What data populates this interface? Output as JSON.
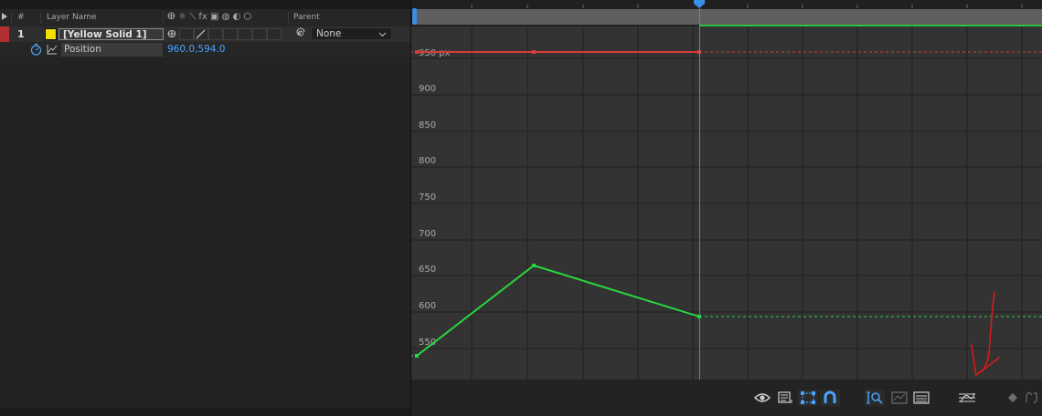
{
  "columns": {
    "number": "#",
    "layer_name": "Layer Name",
    "parent": "Parent",
    "switch_icons": "ⴲ ☼ ⟍ fx ▣ ◍ ◐ ⬡"
  },
  "layer": {
    "index": "1",
    "name": "[Yellow Solid 1]",
    "label_color": "#b2302f",
    "swatch_color": "#f0e000",
    "parent_value": "None"
  },
  "property": {
    "name": "Position",
    "value_x": "960.0",
    "value_sep": ",",
    "value_y": "594.0"
  },
  "graph": {
    "y_ticks": [
      "950 px",
      "900",
      "850",
      "800",
      "750",
      "700",
      "650",
      "600",
      "550"
    ],
    "colors": {
      "x_curve": "#d63b3b",
      "y_curve": "#29d63f",
      "playhead": "#3a8ee6",
      "grid": "#262626",
      "background": "#333333"
    }
  },
  "toolbar": {
    "icons": [
      "eye-icon",
      "properties-list-icon",
      "transform-box-icon",
      "snap-icon",
      "fit-zoom-icon",
      "fit-all-icon",
      "graph-type-icon",
      "easy-ease-icon",
      "keyframe-icon",
      "separate-dimensions-icon"
    ]
  },
  "annotation": {
    "color": "#d11c1c"
  }
}
